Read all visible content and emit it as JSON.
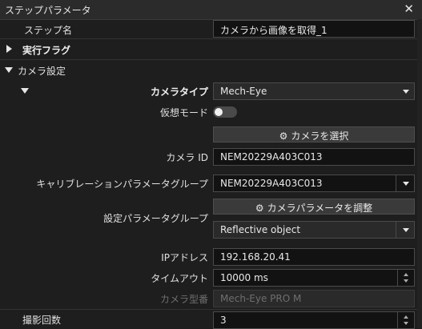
{
  "window": {
    "title": "ステップパラメータ",
    "close": "✕"
  },
  "step_name": {
    "label": "ステップ名",
    "value": "カメラから画像を取得_1"
  },
  "exec_flag": {
    "label": "実行フラグ"
  },
  "camera_settings": {
    "label": "カメラ設定",
    "camera_type": {
      "label": "カメラタイプ",
      "value": "Mech-Eye"
    },
    "virtual_mode": {
      "label": "仮想モード",
      "on": false
    },
    "select_camera_button": "カメラを選択",
    "camera_id": {
      "label": "カメラ ID",
      "value": "NEM20229A403C013"
    },
    "calibration_group": {
      "label": "キャリブレーションパラメータグループ",
      "value": "NEM20229A403C013"
    },
    "adjust_params_button": "カメラパラメータを調整",
    "config_group": {
      "label": "設定パラメータグループ",
      "value": "Reflective object"
    },
    "ip_address": {
      "label": "IPアドレス",
      "value": "192.168.20.41"
    },
    "timeout": {
      "label": "タイムアウト",
      "value": "10000 ms"
    },
    "camera_model": {
      "label": "カメラ型番",
      "value": "Mech-Eye PRO M"
    }
  },
  "capture_count": {
    "label": "撮影回数",
    "value": "3"
  },
  "icons": {
    "gear": "gear-icon",
    "close": "close-icon"
  }
}
